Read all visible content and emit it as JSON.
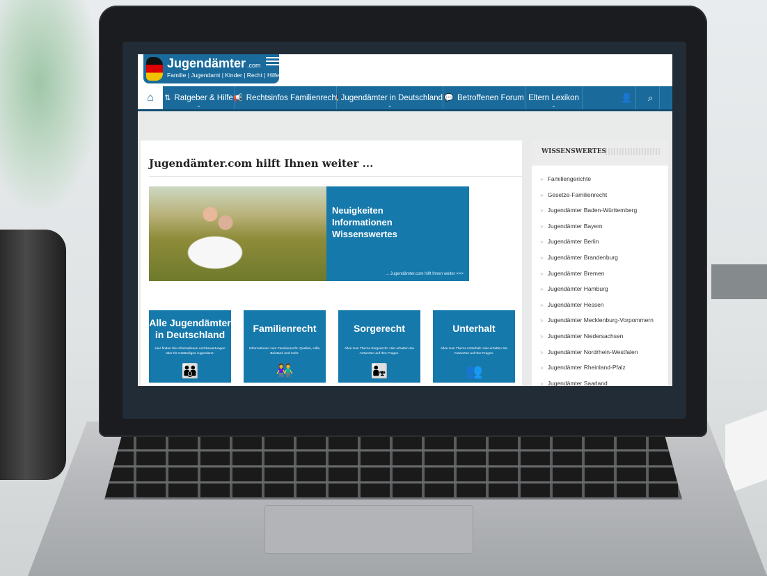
{
  "site": {
    "logo_title": "Jugendämter",
    "logo_domain": ".com",
    "logo_subtitle": "Familie | Jugendamt | Kinder | Recht | Hilfe"
  },
  "nav": {
    "items": [
      {
        "label": "Ratgeber & Hilfe",
        "icon": "sort-icon"
      },
      {
        "label": "Rechtsinfos Familienrecht",
        "icon": "megaphone-icon"
      },
      {
        "label": "Jugendämter in Deutschland",
        "icon": "german-flag-icon"
      },
      {
        "label": "Betroffenen Forum",
        "icon": "chat-icon"
      },
      {
        "label": "Eltern Lexikon",
        "icon": ""
      }
    ]
  },
  "main": {
    "title": "Jugendämter.com hilft Ihnen weiter ...",
    "banner": {
      "line1": "Neuigkeiten",
      "line2": "Informationen",
      "line3": "Wissenswertes",
      "link": "... Jugendämter.com hilft Ihnen weiter >>>"
    },
    "tiles": [
      {
        "title": "Alle Jugendämter in Deutschland",
        "desc": "Hier finden Sie Informationen und Bewertungen über Ihr zuständiges Jugendamt."
      },
      {
        "title": "Familienrecht",
        "desc": "Informationen zum Familienrecht. Quellen, Hilfe, Beistand und mehr."
      },
      {
        "title": "Sorgerecht",
        "desc": "Alles zum Thema Sorgerecht. Hier erhalten Sie Antworten auf Ihre Fragen."
      },
      {
        "title": "Unterhalt",
        "desc": "Alles zum Thema Unterhalt. Hier erhalten Sie Antworten auf Ihre Fragen."
      }
    ]
  },
  "sidebar": {
    "title": "WISSENSWERTES",
    "items": [
      "Familiengerichte",
      "Gesetze-Familienrecht",
      "Jugendämter Baden-Württemberg",
      "Jugendämter Bayern",
      "Jugendämter Berlin",
      "Jugendämter Brandenburg",
      "Jugendämter Bremen",
      "Jugendämter Hamburg",
      "Jugendämter Hessen",
      "Jugendämter Mecklenburg-Vorpommern",
      "Jugendämter Niedersachsen",
      "Jugendämter Nordrhein-Westfalen",
      "Jugendämter Rheinland-Pfalz",
      "Jugendämter Saarland"
    ]
  },
  "colors": {
    "brand_blue": "#1a6b9c",
    "tile_blue": "#1679ac"
  }
}
